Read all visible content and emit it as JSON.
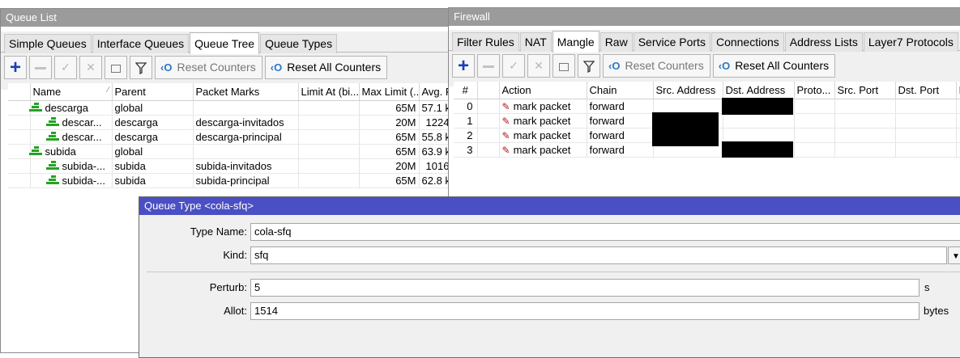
{
  "queue_list": {
    "title": "Queue List",
    "tabs": [
      "Simple Queues",
      "Interface Queues",
      "Queue Tree",
      "Queue Types"
    ],
    "active_tab": "Queue Tree",
    "toolbar": {
      "reset_counters": "Reset Counters",
      "reset_all_counters": "Reset All Counters"
    },
    "columns": [
      "Name",
      "Parent",
      "Packet Marks",
      "Limit At (bi...",
      "Max Limit (...",
      "Avg. R"
    ],
    "rows": [
      {
        "name": "descarga",
        "parent": "global",
        "packet_marks": "",
        "limit_at": "",
        "max_limit": "65M",
        "avg_rate": "57.1 k"
      },
      {
        "name": "descar...",
        "parent": "descarga",
        "packet_marks": "descarga-invitados",
        "limit_at": "",
        "max_limit": "20M",
        "avg_rate": "1224"
      },
      {
        "name": "descar...",
        "parent": "descarga",
        "packet_marks": "descarga-principal",
        "limit_at": "",
        "max_limit": "65M",
        "avg_rate": "55.8 k"
      },
      {
        "name": "subida",
        "parent": "global",
        "packet_marks": "",
        "limit_at": "",
        "max_limit": "65M",
        "avg_rate": "63.9 k"
      },
      {
        "name": "subida-...",
        "parent": "subida",
        "packet_marks": "subida-invitados",
        "limit_at": "",
        "max_limit": "20M",
        "avg_rate": "1016"
      },
      {
        "name": "subida-...",
        "parent": "subida",
        "packet_marks": "subida-principal",
        "limit_at": "",
        "max_limit": "65M",
        "avg_rate": "62.8 k"
      }
    ]
  },
  "firewall": {
    "title": "Firewall",
    "tabs": [
      "Filter Rules",
      "NAT",
      "Mangle",
      "Raw",
      "Service Ports",
      "Connections",
      "Address Lists",
      "Layer7 Protocols"
    ],
    "active_tab": "Mangle",
    "toolbar": {
      "reset_counters": "Reset Counters",
      "reset_all_counters": "Reset All Counters"
    },
    "columns": [
      "#",
      "",
      "Action",
      "Chain",
      "Src. Address",
      "Dst. Address",
      "Proto...",
      "Src. Port",
      "Dst. Port",
      "I"
    ],
    "rows": [
      {
        "num": "0",
        "action": "mark packet",
        "chain": "forward"
      },
      {
        "num": "1",
        "action": "mark packet",
        "chain": "forward"
      },
      {
        "num": "2",
        "action": "mark packet",
        "chain": "forward"
      },
      {
        "num": "3",
        "action": "mark packet",
        "chain": "forward"
      }
    ]
  },
  "queue_type": {
    "title": "Queue Type <cola-sfq>",
    "fields": {
      "type_name_label": "Type Name:",
      "type_name": "cola-sfq",
      "kind_label": "Kind:",
      "kind": "sfq",
      "perturb_label": "Perturb:",
      "perturb": "5",
      "perturb_unit": "s",
      "allot_label": "Allot:",
      "allot": "1514",
      "allot_unit": "bytes"
    }
  },
  "icons": [
    "plus-icon",
    "minus-icon",
    "check-icon",
    "cross-icon",
    "comment-icon",
    "filter-icon",
    "reset-counters-icon",
    "queue-icon",
    "mark-packet-icon",
    "dropdown-arrow-icon"
  ],
  "colors": {
    "active_title": "#4a4fc4",
    "inactive_title": "#9b9b9b",
    "queue_icon": "#23a323",
    "add_icon": "#1a3fb8"
  }
}
